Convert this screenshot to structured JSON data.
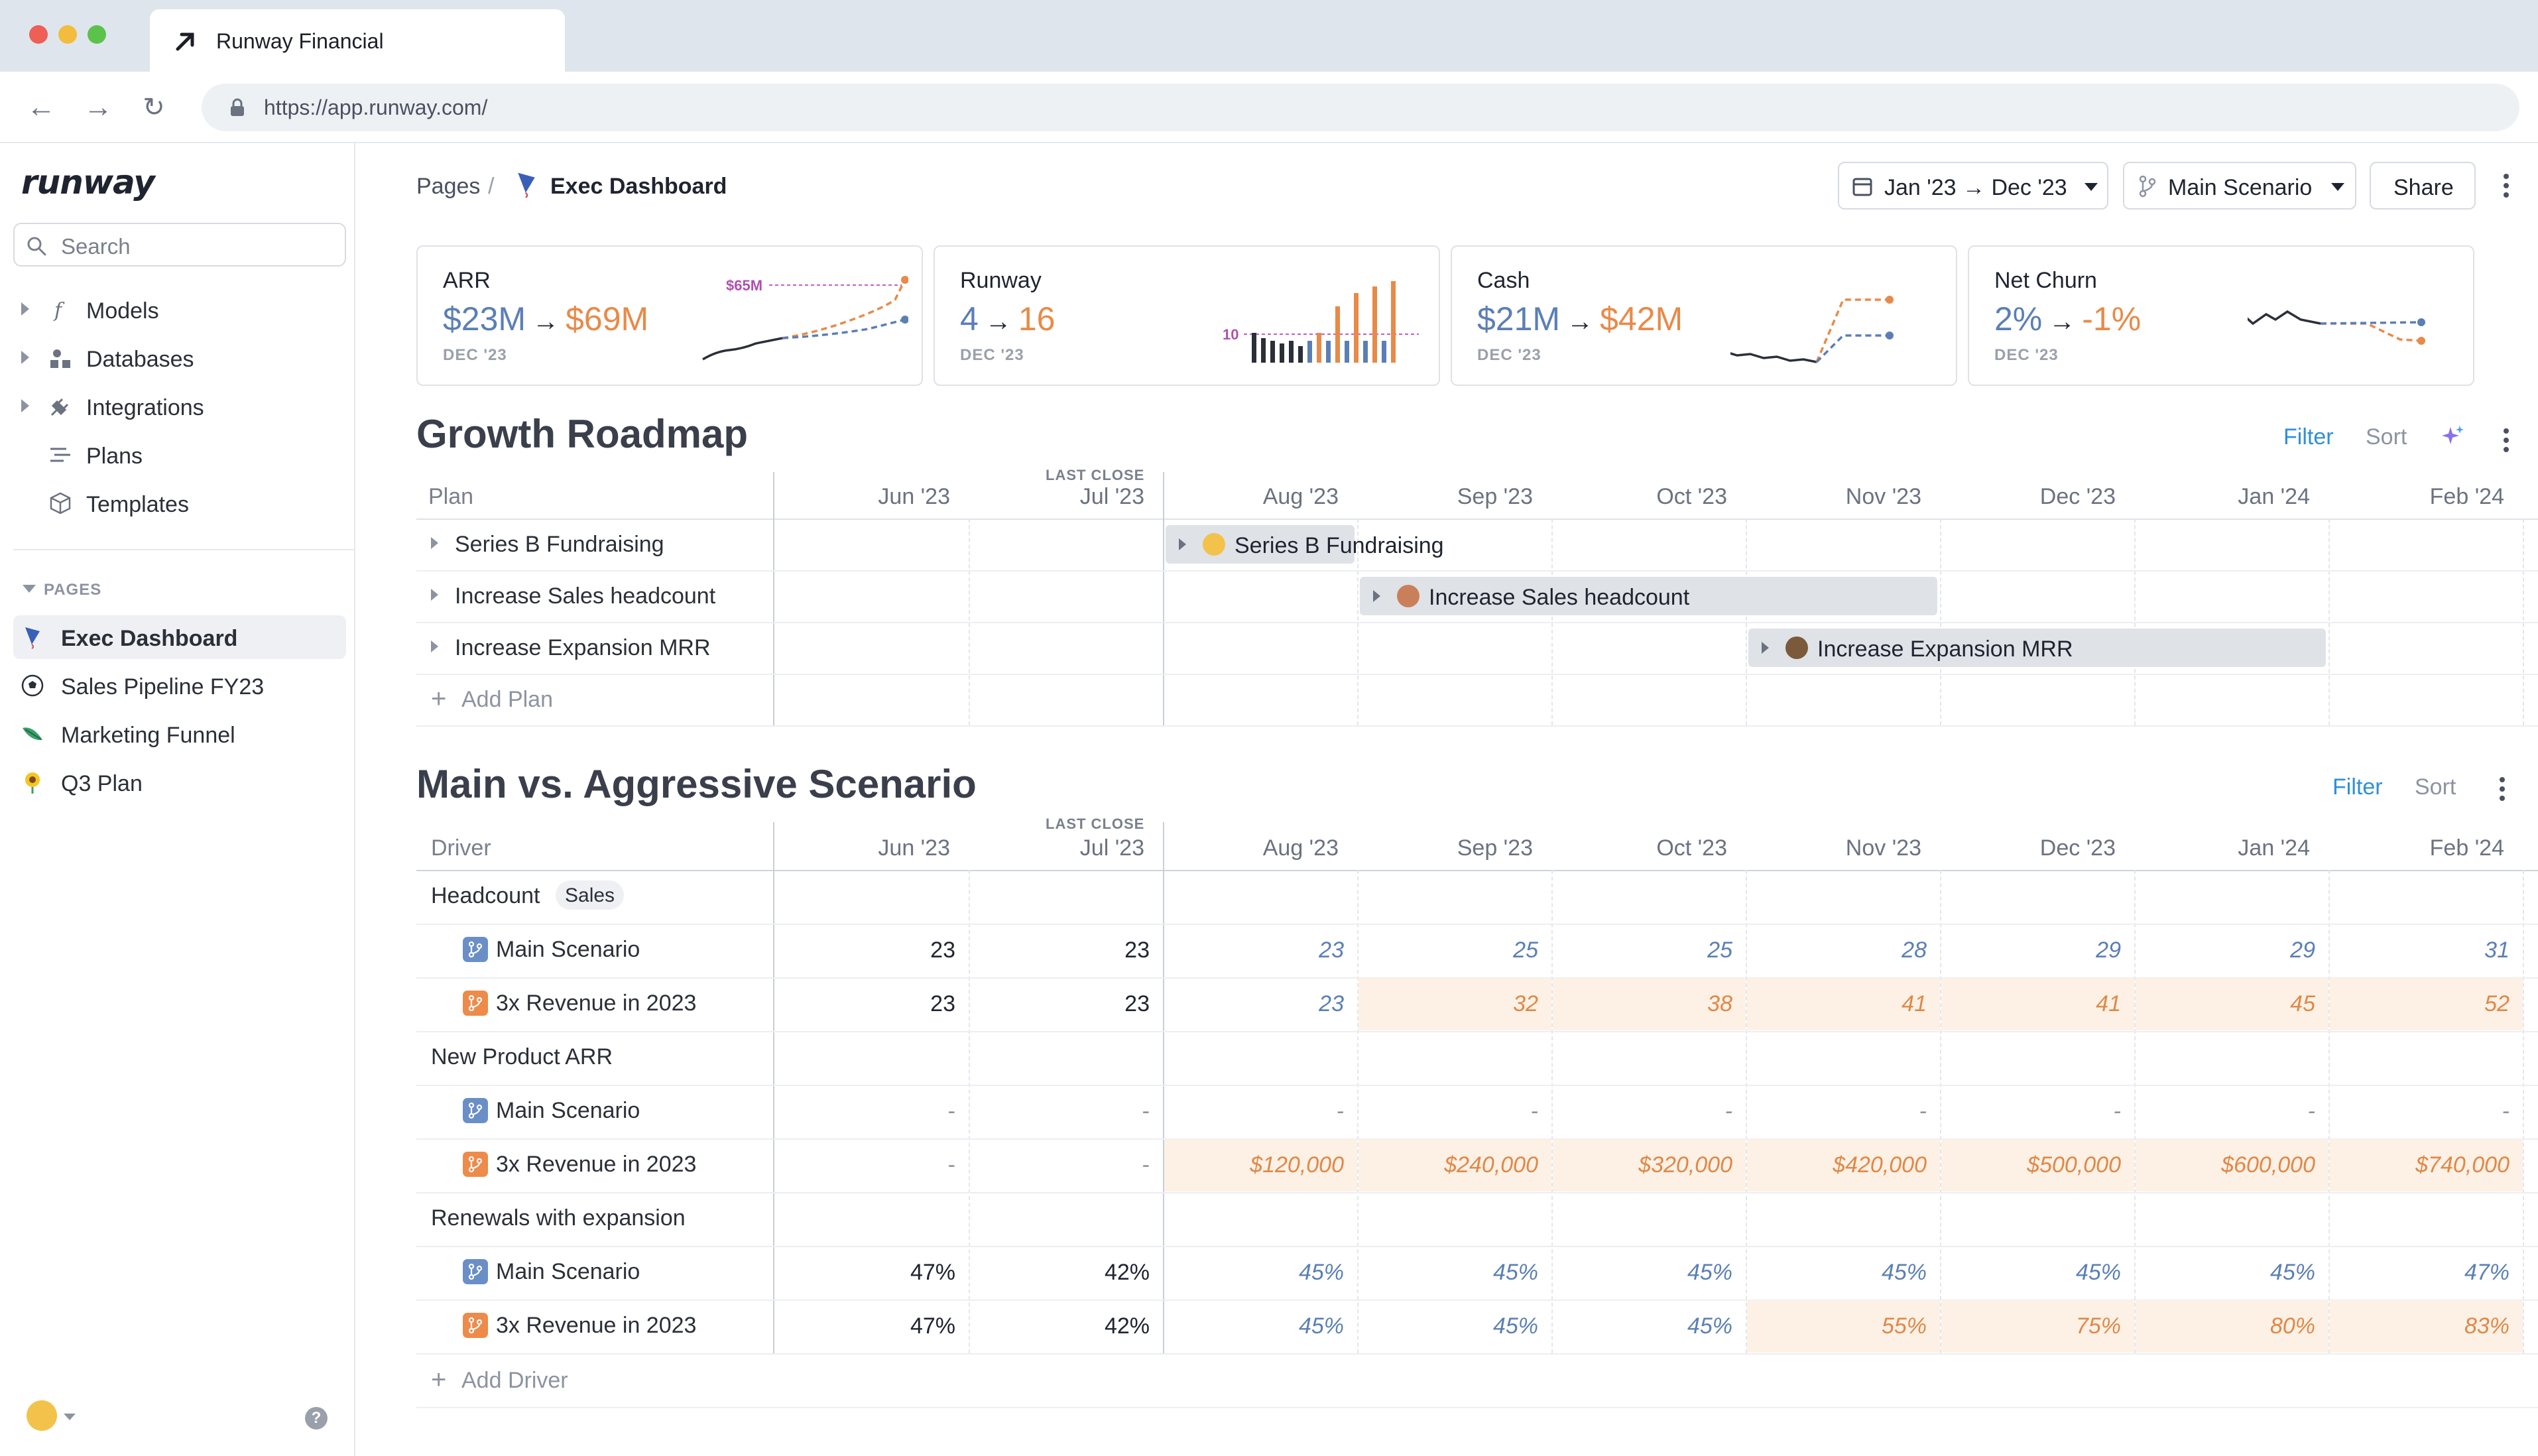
{
  "browser": {
    "tab_title": "Runway Financial",
    "url": "https://app.runway.com/"
  },
  "sidebar": {
    "logo": "runway",
    "search_placeholder": "Search",
    "nav": [
      {
        "label": "Models",
        "icon": "function-icon"
      },
      {
        "label": "Databases",
        "icon": "database-icon"
      },
      {
        "label": "Integrations",
        "icon": "plug-icon"
      },
      {
        "label": "Plans",
        "icon": "plans-icon"
      },
      {
        "label": "Templates",
        "icon": "cube-icon"
      }
    ],
    "pages_header": "PAGES",
    "pages": [
      {
        "label": "Exec Dashboard",
        "icon": "kite-icon",
        "active": true
      },
      {
        "label": "Sales Pipeline FY23",
        "icon": "soccer-ball-icon",
        "active": false
      },
      {
        "label": "Marketing Funnel",
        "icon": "leaf-icon",
        "active": false
      },
      {
        "label": "Q3 Plan",
        "icon": "sunflower-icon",
        "active": false
      }
    ]
  },
  "header": {
    "breadcrumb_pages": "Pages",
    "breadcrumb_sep": "/",
    "page_title": "Exec Dashboard",
    "date_range": "Jan '23 → Dec '23",
    "scenario": "Main Scenario",
    "share": "Share"
  },
  "kpis": [
    {
      "title": "ARR",
      "from": "$23M",
      "to": "$69M",
      "date": "DEC '23",
      "target_label": "$65M"
    },
    {
      "title": "Runway",
      "from": "4",
      "to": "16",
      "date": "DEC '23",
      "target_label": "10"
    },
    {
      "title": "Cash",
      "from": "$21M",
      "to": "$42M",
      "date": "DEC '23"
    },
    {
      "title": "Net Churn",
      "from": "2%",
      "to": "-1%",
      "date": "DEC '23"
    }
  ],
  "roadmap": {
    "title": "Growth Roadmap",
    "filter": "Filter",
    "sort": "Sort",
    "plan_header": "Plan",
    "last_close": "LAST CLOSE",
    "months": [
      "Jun '23",
      "Jul '23",
      "Aug '23",
      "Sep '23",
      "Oct '23",
      "Nov '23",
      "Dec '23",
      "Jan '24",
      "Feb '24"
    ],
    "plans": [
      {
        "label": "Series B Fundraising",
        "start_month": "Aug '23",
        "end_month": "Aug '23"
      },
      {
        "label": "Increase Sales headcount",
        "start_month": "Sep '23",
        "end_month": "Nov '23"
      },
      {
        "label": "Increase Expansion MRR",
        "start_month": "Nov '23",
        "end_month": "Jan '24"
      }
    ],
    "add_label": "Add Plan"
  },
  "scenario_table": {
    "title": "Main vs. Aggressive Scenario",
    "filter": "Filter",
    "sort": "Sort",
    "driver_header": "Driver",
    "last_close": "LAST CLOSE",
    "months": [
      "Jun '23",
      "Jul '23",
      "Aug '23",
      "Sep '23",
      "Oct '23",
      "Nov '23",
      "Dec '23",
      "Jan '24",
      "Feb '24"
    ],
    "groups": [
      {
        "label": "Headcount",
        "tag": "Sales",
        "rows": [
          {
            "scenario": "Main Scenario",
            "values": [
              "23",
              "23",
              "23",
              "25",
              "25",
              "28",
              "29",
              "29",
              "31"
            ]
          },
          {
            "scenario": "3x Revenue in 2023",
            "values": [
              "23",
              "23",
              "23",
              "32",
              "38",
              "41",
              "41",
              "45",
              "52"
            ]
          }
        ]
      },
      {
        "label": "New Product ARR",
        "tag": "",
        "rows": [
          {
            "scenario": "Main Scenario",
            "values": [
              "-",
              "-",
              "-",
              "-",
              "-",
              "-",
              "-",
              "-",
              "-"
            ]
          },
          {
            "scenario": "3x Revenue in 2023",
            "values": [
              "-",
              "-",
              "$120,000",
              "$240,000",
              "$320,000",
              "$420,000",
              "$500,000",
              "$600,000",
              "$740,000"
            ]
          }
        ]
      },
      {
        "label": "Renewals with expansion",
        "tag": "",
        "rows": [
          {
            "scenario": "Main Scenario",
            "values": [
              "47%",
              "42%",
              "45%",
              "45%",
              "45%",
              "45%",
              "45%",
              "45%",
              "47%"
            ]
          },
          {
            "scenario": "3x Revenue in 2023",
            "values": [
              "47%",
              "42%",
              "45%",
              "45%",
              "45%",
              "55%",
              "75%",
              "80%",
              "83%"
            ]
          }
        ]
      }
    ],
    "add_label": "Add Driver"
  },
  "colors": {
    "main_blue": "#5b7fb5",
    "aggressive_orange": "#e88a48",
    "accent_blue": "#2f8fd8",
    "highlight_cell": "#fdf1e6"
  }
}
